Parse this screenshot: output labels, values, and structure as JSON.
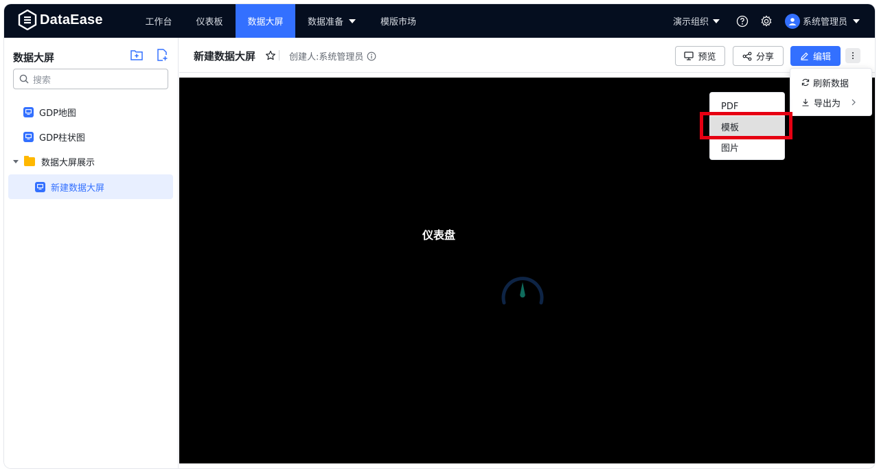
{
  "brand": {
    "name": "DataEase"
  },
  "nav": {
    "items": [
      {
        "label": "工作台"
      },
      {
        "label": "仪表板"
      },
      {
        "label": "数据大屏"
      },
      {
        "label": "数据准备"
      },
      {
        "label": "模版市场"
      }
    ],
    "org": "演示组织",
    "user": "系统管理员"
  },
  "sidebar": {
    "title": "数据大屏",
    "search_placeholder": "搜索",
    "items": [
      {
        "label": "GDP地图"
      },
      {
        "label": "GDP柱状图"
      },
      {
        "label": "数据大屏展示"
      },
      {
        "label": "新建数据大屏"
      }
    ]
  },
  "header": {
    "title": "新建数据大屏",
    "creator": "创建人:系统管理员",
    "preview_label": "预览",
    "share_label": "分享",
    "edit_label": "编辑"
  },
  "more_menu": {
    "refresh_label": "刷新数据",
    "export_label": "导出为"
  },
  "export_menu": {
    "items": [
      "PDF",
      "模板",
      "图片"
    ]
  },
  "canvas": {
    "widget_title": "仪表盘"
  },
  "colors": {
    "nav_bg": "#050e1f",
    "accent": "#3370ff",
    "highlight": "#e60012",
    "folder": "#ffb800"
  }
}
